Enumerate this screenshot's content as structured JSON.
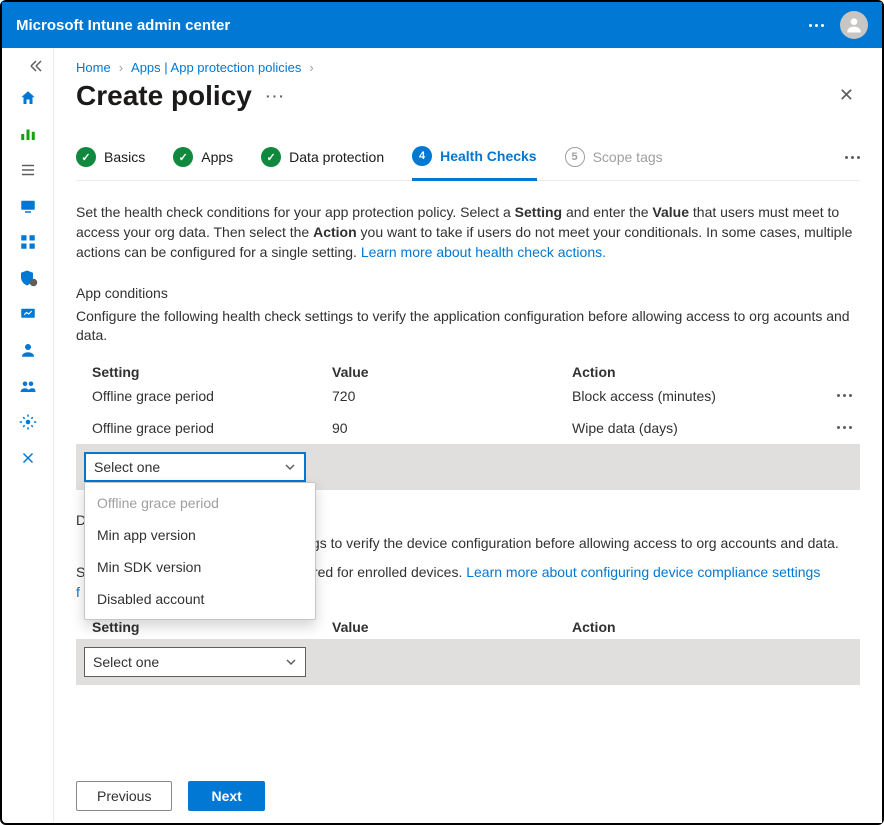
{
  "topbar": {
    "title": "Microsoft Intune admin center"
  },
  "breadcrumb": {
    "home": "Home",
    "apps": "Apps | App protection policies"
  },
  "page": {
    "title": "Create policy"
  },
  "steps": {
    "basics": "Basics",
    "apps": "Apps",
    "data_protection": "Data protection",
    "health_checks": "Health Checks",
    "scope_tags": "Scope tags",
    "num_active": "4",
    "num_future": "5"
  },
  "intro": {
    "p1a": "Set the health check conditions for your app protection policy. Select a ",
    "b1": "Setting",
    "p1b": " and enter the ",
    "b2": "Value",
    "p1c": " that users must meet to access your org data. Then select the ",
    "b3": "Action",
    "p1d": " you want to take if users do not meet your conditionals. In some cases, multiple actions can be configured for a single setting. ",
    "learn": "Learn more about health check actions."
  },
  "app_conditions": {
    "heading": "App conditions",
    "sub": "Configure the following health check settings to verify the application configuration before allowing access to org acounts and data.",
    "col_setting": "Setting",
    "col_value": "Value",
    "col_action": "Action",
    "rows": [
      {
        "setting": "Offline grace period",
        "value": "720",
        "action": "Block access (minutes)"
      },
      {
        "setting": "Offline grace period",
        "value": "90",
        "action": "Wipe data (days)"
      }
    ],
    "select_placeholder": "Select one",
    "dropdown_opts": {
      "offline": "Offline grace period",
      "min_app": "Min app version",
      "min_sdk": "Min SDK version",
      "disabled_acct": "Disabled account"
    }
  },
  "device_conditions": {
    "heading_char": "D",
    "sub_fragment": "ngs to verify the device configuration before allowing access to org accounts and data.",
    "sub2_prefix": "S",
    "sub2_fragment": "gured for enrolled devices. ",
    "sub2_link": "Learn more about configuring device compliance settings",
    "sub2_after_prefix": "f",
    "col_setting": "Setting",
    "col_value": "Value",
    "col_action": "Action",
    "select_placeholder": "Select one"
  },
  "footer": {
    "previous": "Previous",
    "next": "Next"
  }
}
